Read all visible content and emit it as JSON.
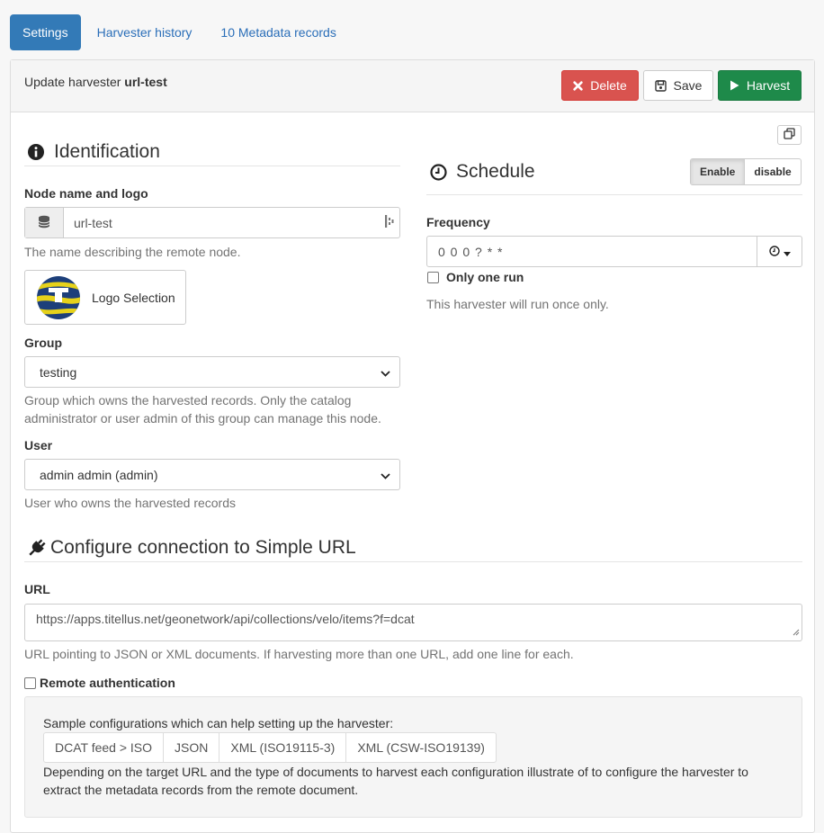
{
  "tabs": [
    {
      "label": "Settings",
      "active": true
    },
    {
      "label": "Harvester history"
    },
    {
      "label": "10 Metadata records"
    }
  ],
  "header": {
    "title_prefix": "Update harvester",
    "title_name": "url-test",
    "delete_label": "Delete",
    "save_label": "Save",
    "harvest_label": "Harvest"
  },
  "identification": {
    "heading": "Identification",
    "node_label": "Node name and logo",
    "node_value": "url-test",
    "node_help": "The name describing the remote node.",
    "logo_label": "Logo Selection",
    "group_label": "Group",
    "group_value": "testing",
    "group_help": "Group which owns the harvested records. Only the catalog administrator or user admin of this group can manage this node.",
    "user_label": "User",
    "user_value": "admin admin (admin)",
    "user_help": "User who owns the harvested records"
  },
  "schedule": {
    "heading": "Schedule",
    "enable_label": "Enable",
    "disable_label": "disable",
    "frequency_label": "Frequency",
    "frequency_value": "0 0 0 ? * *",
    "only_one_run_label": "Only one run",
    "help": "This harvester will run once only."
  },
  "connection": {
    "heading": "Configure connection to Simple URL",
    "url_label": "URL",
    "url_value": "https://apps.titellus.net/geonetwork/api/collections/velo/items?f=dcat",
    "url_help": "URL pointing to JSON or XML documents. If harvesting more than one URL, add one line for each.",
    "remote_auth_label": "Remote authentication",
    "sample_title": "Sample configurations which can help setting up the harvester:",
    "samples": [
      "DCAT feed > ISO",
      "JSON",
      "XML (ISO19115-3)",
      "XML (CSW-ISO19139)"
    ],
    "sample_help": "Depending on the target URL and the type of documents to harvest each configuration illustrate of to configure the harvester to extract the metadata records from the remote document."
  },
  "colors": {
    "primary": "#337ab7",
    "danger": "#d9534f",
    "success": "#1e8a4a",
    "link": "#2a6eb8"
  }
}
